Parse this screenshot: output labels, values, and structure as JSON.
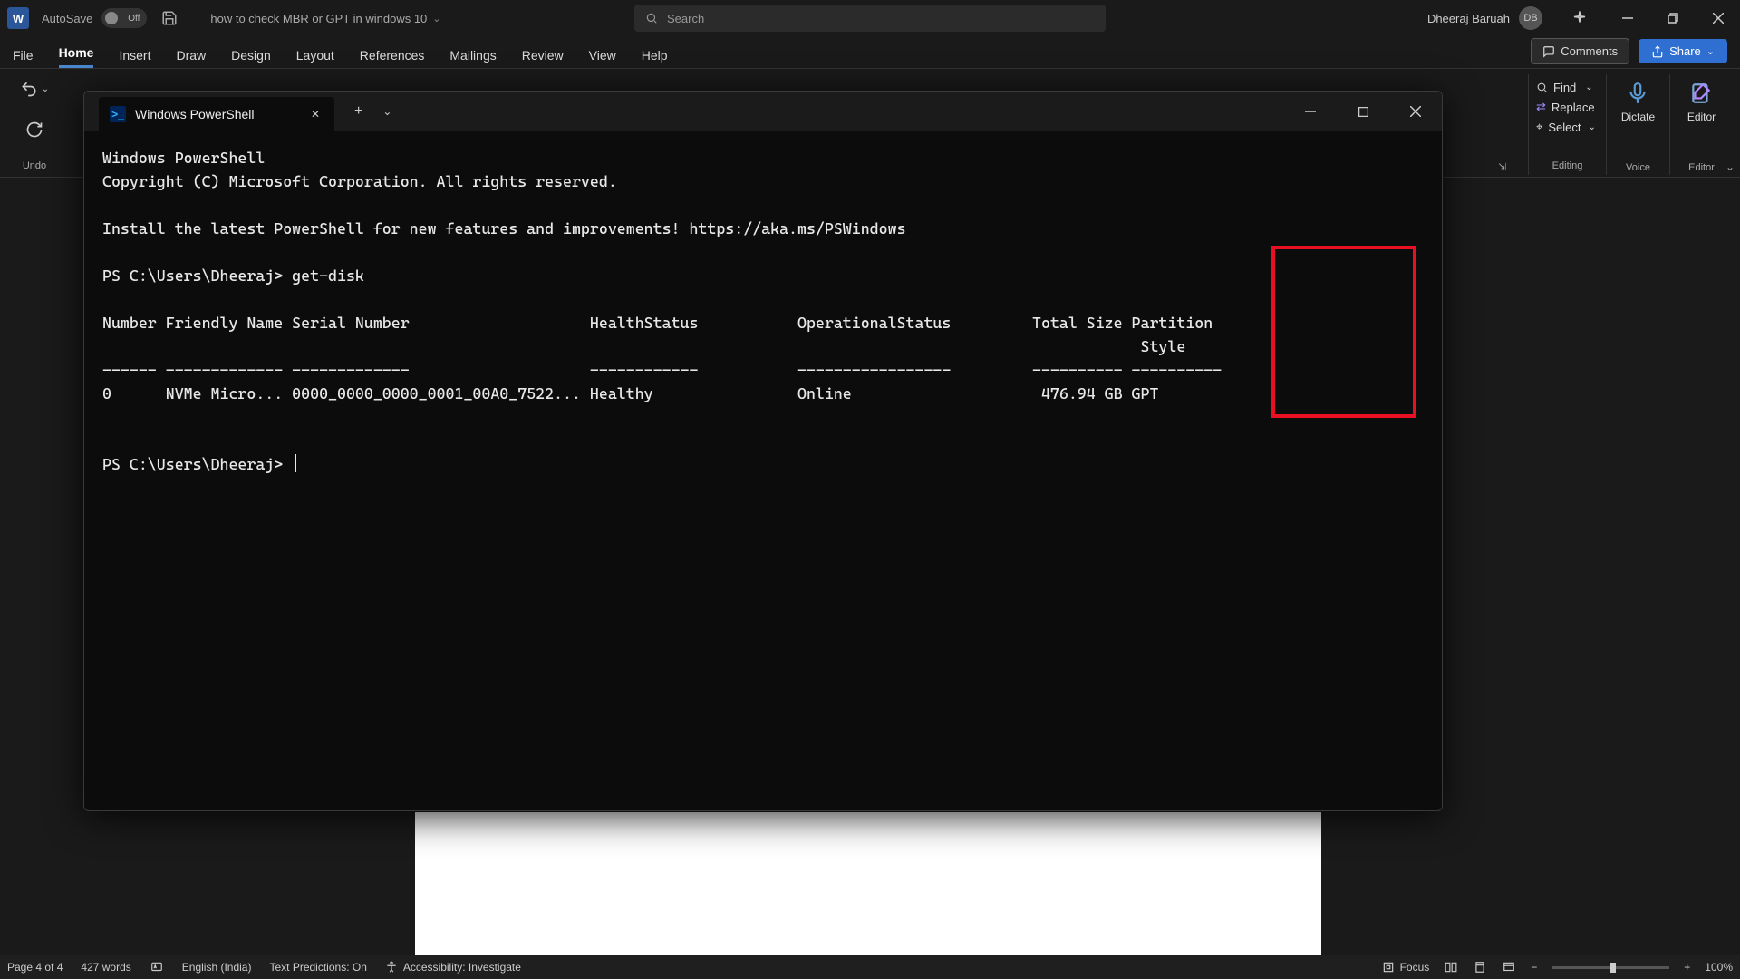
{
  "titlebar": {
    "autosave_label": "AutoSave",
    "autosave_state": "Off",
    "doc_name": "how to check MBR or GPT in windows 10",
    "search_placeholder": "Search",
    "user_name": "Dheeraj Baruah",
    "user_initials": "DB"
  },
  "ribbon": {
    "tabs": [
      "File",
      "Home",
      "Insert",
      "Draw",
      "Design",
      "Layout",
      "References",
      "Mailings",
      "Review",
      "View",
      "Help"
    ],
    "active_tab": 1,
    "comments_label": "Comments",
    "share_label": "Share",
    "undo_label": "Undo",
    "editing": {
      "find": "Find",
      "replace": "Replace",
      "select": "Select",
      "group_label": "Editing"
    },
    "voice": {
      "dictate": "Dictate",
      "group_label": "Voice"
    },
    "editor": {
      "editor": "Editor",
      "group_label": "Editor"
    }
  },
  "terminal": {
    "tab_title": "Windows PowerShell",
    "lines": {
      "l1": "Windows PowerShell",
      "l2": "Copyright (C) Microsoft Corporation. All rights reserved.",
      "l3": "Install the latest PowerShell for new features and improvements! https://aka.ms/PSWindows",
      "l4": "PS C:\\Users\\Dheeraj> get-disk",
      "header": "Number Friendly Name Serial Number                    HealthStatus           OperationalStatus         Total Size Partition",
      "header2": "                                                                                                                   Style",
      "sep": "------ ------------- -------------                    ------------           -----------------         ---------- ----------",
      "row": "0      NVMe Micro... 0000_0000_0000_0001_00A0_7522... Healthy                Online                     476.94 GB GPT",
      "l5": "PS C:\\Users\\Dheeraj> "
    },
    "disk_data": {
      "number": 0,
      "friendly_name": "NVMe Micro...",
      "serial_number": "0000_0000_0000_0001_00A0_7522...",
      "health_status": "Healthy",
      "operational_status": "Online",
      "total_size": "476.94 GB",
      "partition_style": "GPT"
    }
  },
  "statusbar": {
    "page": "Page 4 of 4",
    "words": "427 words",
    "language": "English (India)",
    "predictions": "Text Predictions: On",
    "accessibility": "Accessibility: Investigate",
    "focus": "Focus",
    "zoom_pct": "100%"
  }
}
